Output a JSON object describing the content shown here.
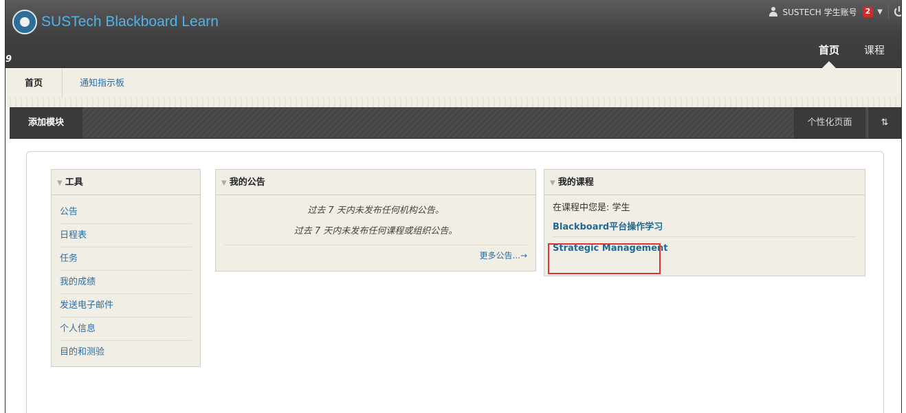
{
  "header": {
    "brand_title": "SUSTech Blackboard Learn",
    "quick_glyph": "9",
    "user_name": "SUSTECH 学生账号",
    "notification_count": "2",
    "caret": "▼",
    "tabs": [
      {
        "label": "首页",
        "active": true
      },
      {
        "label": "课程",
        "active": false
      }
    ]
  },
  "subnav": {
    "tabs": [
      "首页",
      "通知指示板"
    ]
  },
  "module_bar": {
    "add_module": "添加模块",
    "personalize": "个性化页面",
    "sort_icon": "⇅"
  },
  "tools_module": {
    "title": "工具",
    "items": [
      "公告",
      "日程表",
      "任务",
      "我的成绩",
      "发送电子邮件",
      "个人信息",
      "目的和测验"
    ]
  },
  "announcements_module": {
    "title": "我的公告",
    "lines": [
      "过去 7 天内未发布任何机构公告。",
      "过去 7 天内未发布任何课程或组织公告。"
    ],
    "more": "更多公告...→"
  },
  "courses_module": {
    "title": "我的课程",
    "role": "在课程中您是: 学生",
    "courses": [
      "Blackboard平台操作学习",
      "Strategic Management"
    ]
  },
  "colors": {
    "brand": "#4fb3ee",
    "link": "#2a6da5",
    "highlight": "#e03434",
    "badge": "#d12a2a"
  }
}
